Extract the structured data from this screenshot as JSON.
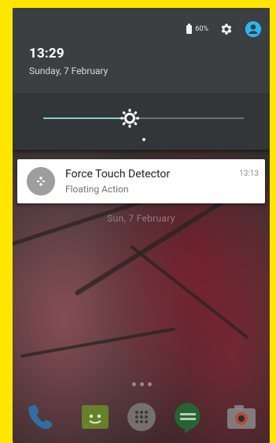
{
  "status_bar": {
    "battery_text": "60%",
    "icons": [
      "battery-icon",
      "settings-gear-icon",
      "account-avatar-icon"
    ],
    "accent_color": "#29b6f6"
  },
  "quick_settings": {
    "time": "13:29",
    "date": "Sunday, 7 February",
    "brightness_level": 0.43,
    "brightness_icon": "brightness-icon",
    "slider_color": "#7fd0cf"
  },
  "notification": {
    "title": "Force Touch Detector",
    "subtitle": "Floating Action",
    "time": "13:13",
    "icon": "app-touch-icon"
  },
  "wallpaper": {
    "date_text": "Sun, 7 February"
  },
  "dock": {
    "apps": [
      "phone-icon",
      "messaging-icon",
      "app-drawer-icon",
      "hangouts-icon",
      "camera-icon"
    ]
  }
}
